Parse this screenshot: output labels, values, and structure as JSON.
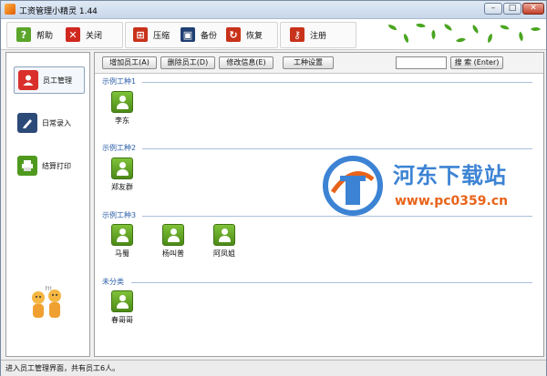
{
  "window": {
    "title": "工资管理小精灵 1.44"
  },
  "toolbar": {
    "help_label": "帮助",
    "close_label": "关闭",
    "compress_label": "压缩",
    "backup_label": "备份",
    "restore_label": "恢复",
    "register_label": "注册"
  },
  "sidebar": {
    "items": [
      {
        "label": "员工管理",
        "icon": "person-icon",
        "color": "#d9302b",
        "active": true
      },
      {
        "label": "日常录入",
        "icon": "pen-icon",
        "color": "#2c4a78",
        "active": false
      },
      {
        "label": "结算打印",
        "icon": "printer-icon",
        "color": "#4f9a1e",
        "active": false
      }
    ]
  },
  "actions": {
    "add_label": "增加员工(A)",
    "delete_label": "删除员工(D)",
    "edit_label": "修改信息(E)",
    "worktype_label": "工种设置",
    "search_value": "",
    "search_label": "搜 索 (Enter)"
  },
  "groups": [
    {
      "name": "示例工种1",
      "employees": [
        "李东"
      ]
    },
    {
      "name": "示例工种2",
      "employees": [
        "郑友群"
      ]
    },
    {
      "name": "示例工种3",
      "employees": [
        "马蜀",
        "杨叫普",
        "阿凤姐"
      ]
    },
    {
      "name": "未分类",
      "employees": [
        "春哥哥"
      ]
    }
  ],
  "watermark": {
    "title": "河东下载站",
    "url": "www.pc0359.cn"
  },
  "status": {
    "text": "进入员工管理界面，共有员工6人。"
  },
  "colors": {
    "accent_blue": "#2b5ea8",
    "employee_green": "#5a9e1f",
    "watermark_blue": "#3c83d4",
    "watermark_orange": "#e8631a"
  }
}
